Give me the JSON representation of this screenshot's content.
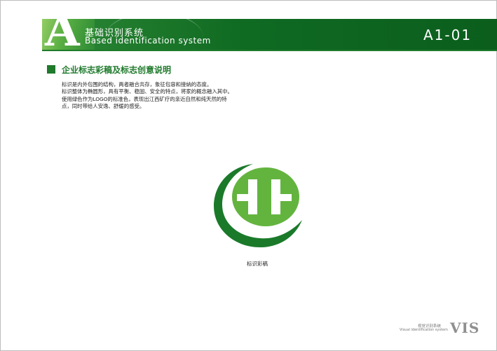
{
  "header": {
    "letter": "A",
    "title_cn": "基础识别系统",
    "title_en": "Based identification system",
    "page_code": "A1-01"
  },
  "section": {
    "title": "企业标志彩稿及标志创意说明",
    "lines": [
      "标识是内外包围的结构，两者融合共存，象征包容和接纳的态度。",
      "标识整体为椭圆形，具有平衡、稳固、安全的特点，将家的概念融入其中。",
      "使用绿色作为LOGO的标准色，表现出江西矿疗的亲近自然和纯天然的特",
      "点，同时带给人安逸、舒缓的感受。"
    ]
  },
  "logo": {
    "caption": "标识彩稿",
    "colors": {
      "dark_green": "#1a7a2a",
      "light_green": "#63b43f"
    }
  },
  "footer": {
    "cn": "视觉识别系统",
    "en": "Visual identification system",
    "mark": "VIS"
  },
  "colors": {
    "brand_green": "#1f7a2c",
    "border": "#bdbdbd"
  }
}
